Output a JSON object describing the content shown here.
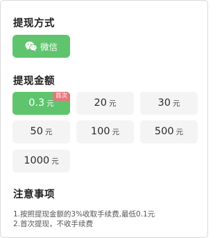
{
  "withdraw_method": {
    "title": "提现方式",
    "wechat_label": "微信",
    "accent_color": "#5fc46d"
  },
  "withdraw_amount": {
    "title": "提现金额",
    "unit": "元",
    "first_badge": "首次",
    "options": [
      "0.3",
      "20",
      "30",
      "50",
      "100",
      "500",
      "1000"
    ],
    "selected_index": 0
  },
  "notes": {
    "title": "注意事项",
    "lines": [
      "1.按照提现金额的3%收取手续费,最低0.1元",
      "2.首次提现，不收手续费"
    ]
  }
}
